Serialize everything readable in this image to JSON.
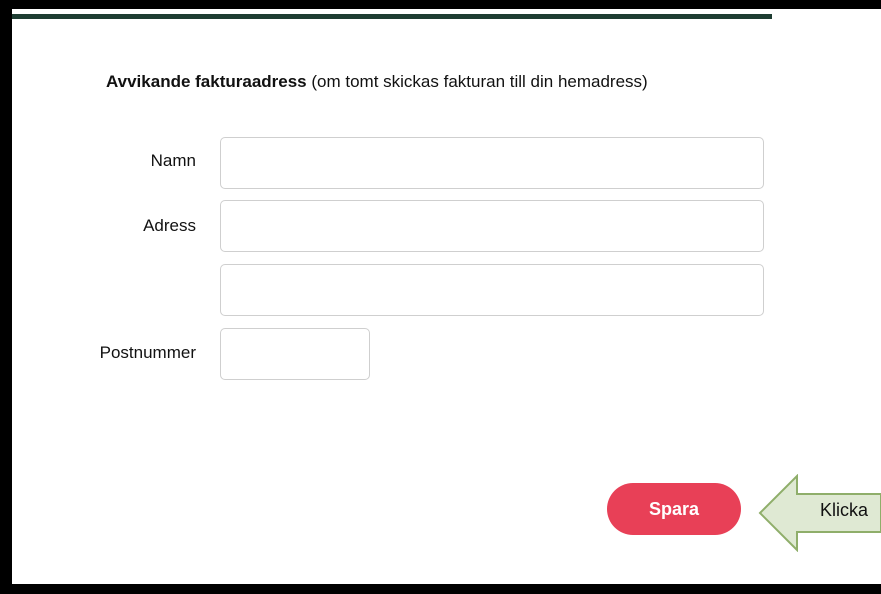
{
  "heading": {
    "bold": "Avvikande fakturaadress",
    "rest": " (om tomt skickas fakturan till din hemadress)"
  },
  "form": {
    "name_label": "Namn",
    "address_label": "Adress",
    "postal_label": "Postnummer",
    "name_value": "",
    "address_value_1": "",
    "address_value_2": "",
    "postal_value": ""
  },
  "actions": {
    "save_label": "Spara"
  },
  "callout": {
    "text": "Klicka"
  },
  "colors": {
    "frame": "#000000",
    "accent_line": "#1e3d32",
    "button": "#e84057",
    "callout_fill": "#dfe9d3",
    "callout_stroke": "#8fae6a"
  }
}
